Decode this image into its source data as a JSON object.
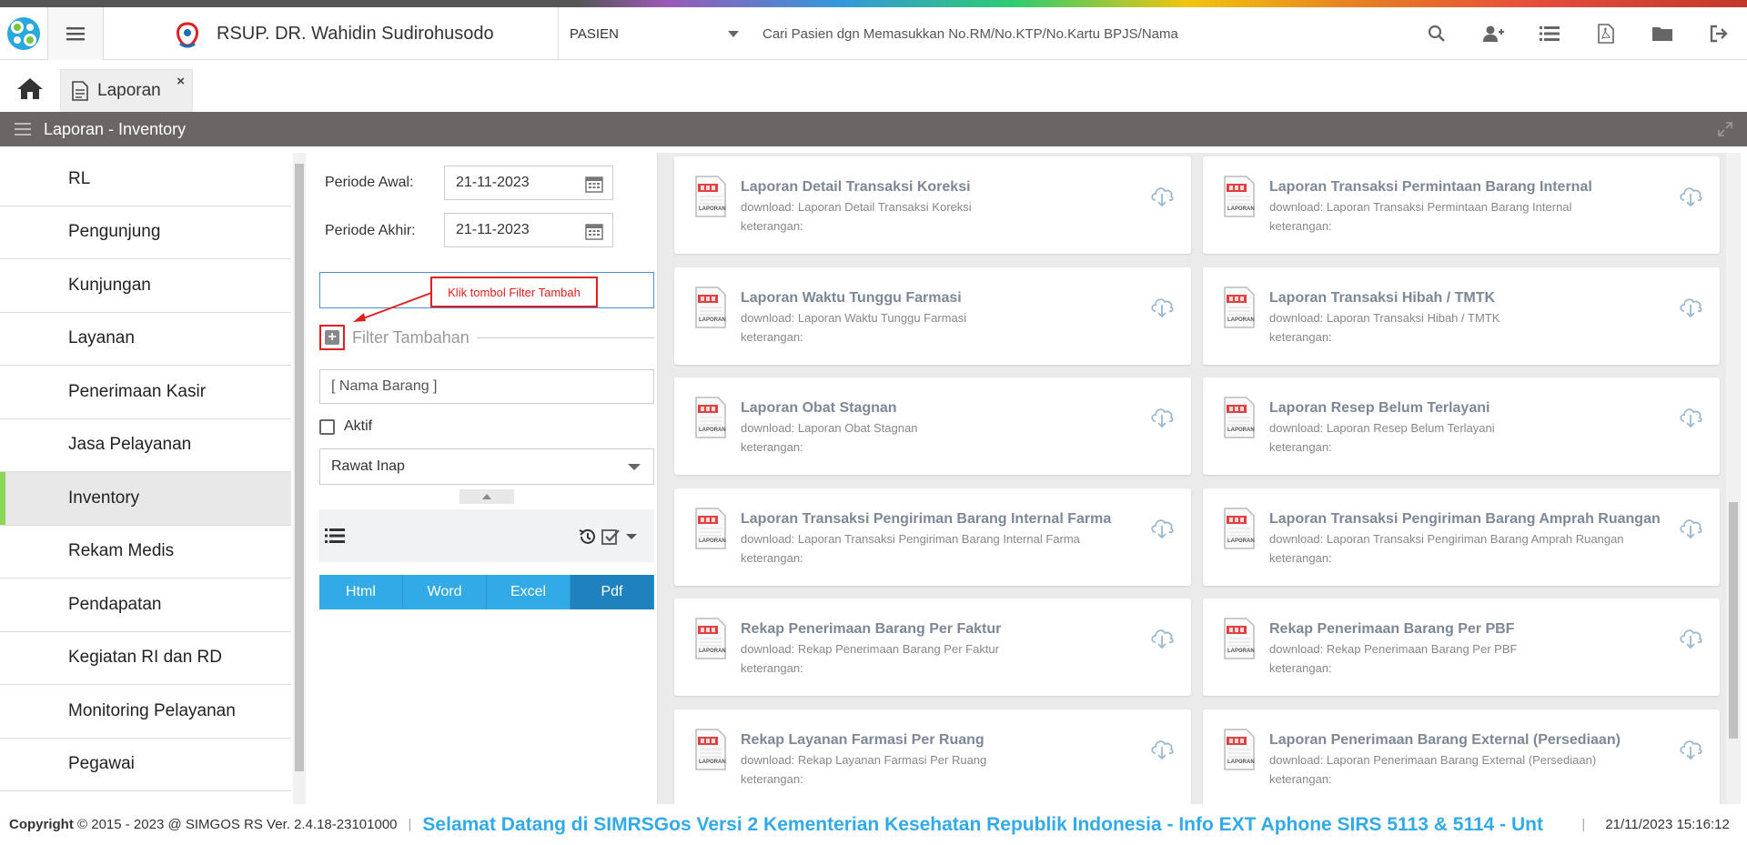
{
  "header": {
    "hospital_name": "RSUP. DR. Wahidin Sudirohusodo",
    "patient_mode": "PASIEN",
    "search_placeholder": "Cari Pasien dgn Memasukkan No.RM/No.KTP/No.Kartu BPJS/Nama",
    "icons": [
      "search-icon",
      "add-user-icon",
      "list-icon",
      "pdf-icon",
      "folder-icon",
      "logout-icon"
    ]
  },
  "tabs": [
    {
      "label": "Laporan",
      "close": "×"
    }
  ],
  "titlebar": {
    "title": "Laporan - Inventory"
  },
  "sidebar": {
    "items": [
      {
        "label": "RL"
      },
      {
        "label": "Pengunjung"
      },
      {
        "label": "Kunjungan"
      },
      {
        "label": "Layanan"
      },
      {
        "label": "Penerimaan Kasir"
      },
      {
        "label": "Jasa Pelayanan"
      },
      {
        "label": "Inventory",
        "active": true
      },
      {
        "label": "Rekam Medis"
      },
      {
        "label": "Pendapatan"
      },
      {
        "label": "Kegiatan RI dan RD"
      },
      {
        "label": "Monitoring Pelayanan"
      },
      {
        "label": "Pegawai"
      }
    ]
  },
  "filter": {
    "periode_awal_label": "Periode Awal:",
    "periode_awal_value": "21-11-2023",
    "periode_akhir_label": "Periode Akhir:",
    "periode_akhir_value": "21-11-2023",
    "callout": "Klik tombol Filter Tambah",
    "filter_tambahan": "Filter Tambahan",
    "nama_barang_placeholder": "[ Nama Barang ]",
    "aktif_label": "Aktif",
    "rawat_value": "Rawat Inap",
    "formats": [
      "Html",
      "Word",
      "Excel",
      "Pdf"
    ],
    "active_format": "Pdf"
  },
  "reports": [
    {
      "title": "Laporan Detail Transaksi Koreksi",
      "download": "download: Laporan Detail Transaksi Koreksi",
      "keterangan": "keterangan:"
    },
    {
      "title": "Laporan Transaksi Permintaan Barang Internal",
      "download": "download: Laporan Transaksi Permintaan Barang Internal",
      "keterangan": "keterangan:"
    },
    {
      "title": "Laporan Waktu Tunggu Farmasi",
      "download": "download: Laporan Waktu Tunggu Farmasi",
      "keterangan": "keterangan:"
    },
    {
      "title": "Laporan Transaksi Hibah / TMTK",
      "download": "download: Laporan Transaksi Hibah / TMTK",
      "keterangan": "keterangan:"
    },
    {
      "title": "Laporan Obat Stagnan",
      "download": "download: Laporan Obat Stagnan",
      "keterangan": "keterangan:"
    },
    {
      "title": "Laporan Resep Belum Terlayani",
      "download": "download: Laporan Resep Belum Terlayani",
      "keterangan": "keterangan:"
    },
    {
      "title": "Laporan Transaksi Pengiriman Barang Internal Farma",
      "download": "download: Laporan Transaksi Pengiriman Barang Internal Farma",
      "keterangan": "keterangan:"
    },
    {
      "title": "Laporan Transaksi Pengiriman Barang Amprah Ruangan",
      "download": "download: Laporan Transaksi Pengiriman Barang Amprah Ruangan",
      "keterangan": "keterangan:"
    },
    {
      "title": "Rekap Penerimaan Barang Per Faktur",
      "download": "download: Rekap Penerimaan Barang Per Faktur",
      "keterangan": "keterangan:"
    },
    {
      "title": "Rekap Penerimaan Barang Per PBF",
      "download": "download: Rekap Penerimaan Barang Per PBF",
      "keterangan": "keterangan:"
    },
    {
      "title": "Rekap Layanan Farmasi Per Ruang",
      "download": "download: Rekap Layanan Farmasi Per Ruang",
      "keterangan": "keterangan:"
    },
    {
      "title": "Laporan Penerimaan Barang External (Persediaan)",
      "download": "download: Laporan Penerimaan Barang External (Persediaan)",
      "keterangan": "keterangan:"
    }
  ],
  "pdf_label": "LAPORAN",
  "footer": {
    "copyright": "Copyright",
    "years": "2015 - 2023 @ SIMGOS RS Ver. 2.4.18-23101000",
    "marquee": "Selamat Datang di SIMRSGos Versi 2 Kementerian Kesehatan Republik Indonesia - Info EXT Aphone SIRS 5113 & 5114 - Unt",
    "datetime": "21/11/2023 15:16:12"
  },
  "colors": {
    "accent": "#33aae8",
    "active_format": "#1f82bf",
    "titlebar": "#6b6665",
    "callout": "#e02020",
    "sidebar_active": "#8bd65a"
  }
}
